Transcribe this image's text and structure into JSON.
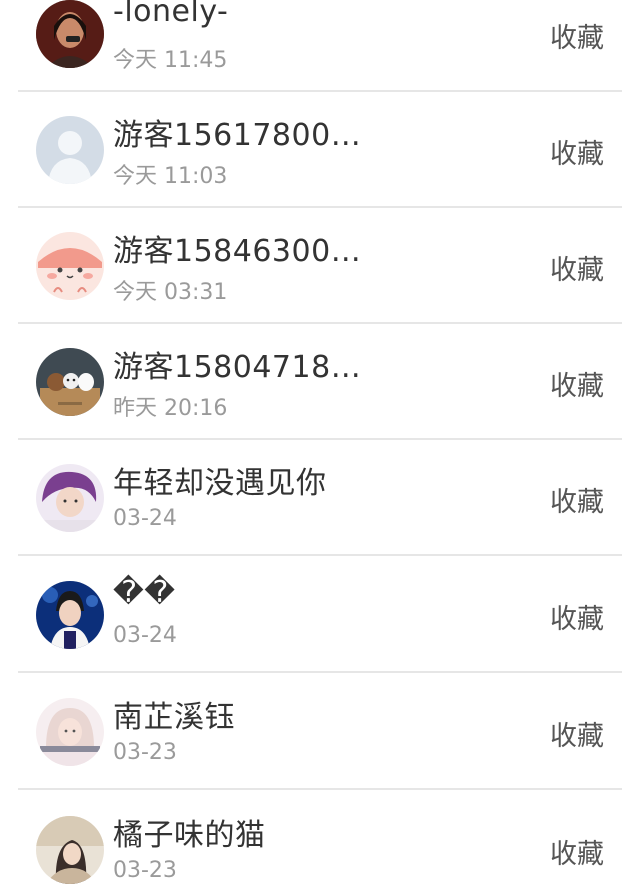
{
  "items": [
    {
      "name": "-lonely-",
      "time": "今天 11:45",
      "action": "收藏",
      "avatar": "avatar-dark-portrait"
    },
    {
      "name": "游客15617800…",
      "time": "今天 11:03",
      "action": "收藏",
      "avatar": "avatar-default-person"
    },
    {
      "name": "游客15846300…",
      "time": "今天 03:31",
      "action": "收藏",
      "avatar": "avatar-pink-cartoon"
    },
    {
      "name": "游客15804718…",
      "time": "昨天 20:16",
      "action": "收藏",
      "avatar": "avatar-bears-cartoon"
    },
    {
      "name": "年轻却没遇见你",
      "time": "03-24",
      "action": "收藏",
      "avatar": "avatar-purple-portrait"
    },
    {
      "name": "��",
      "time": "03-24",
      "action": "收藏",
      "avatar": "avatar-blue-stage-portrait"
    },
    {
      "name": "南芷溪钰",
      "time": "03-23",
      "action": "收藏",
      "avatar": "avatar-pastel-girl"
    },
    {
      "name": "橘子味的猫",
      "time": "03-23",
      "action": "收藏",
      "avatar": "avatar-soft-portrait"
    }
  ]
}
